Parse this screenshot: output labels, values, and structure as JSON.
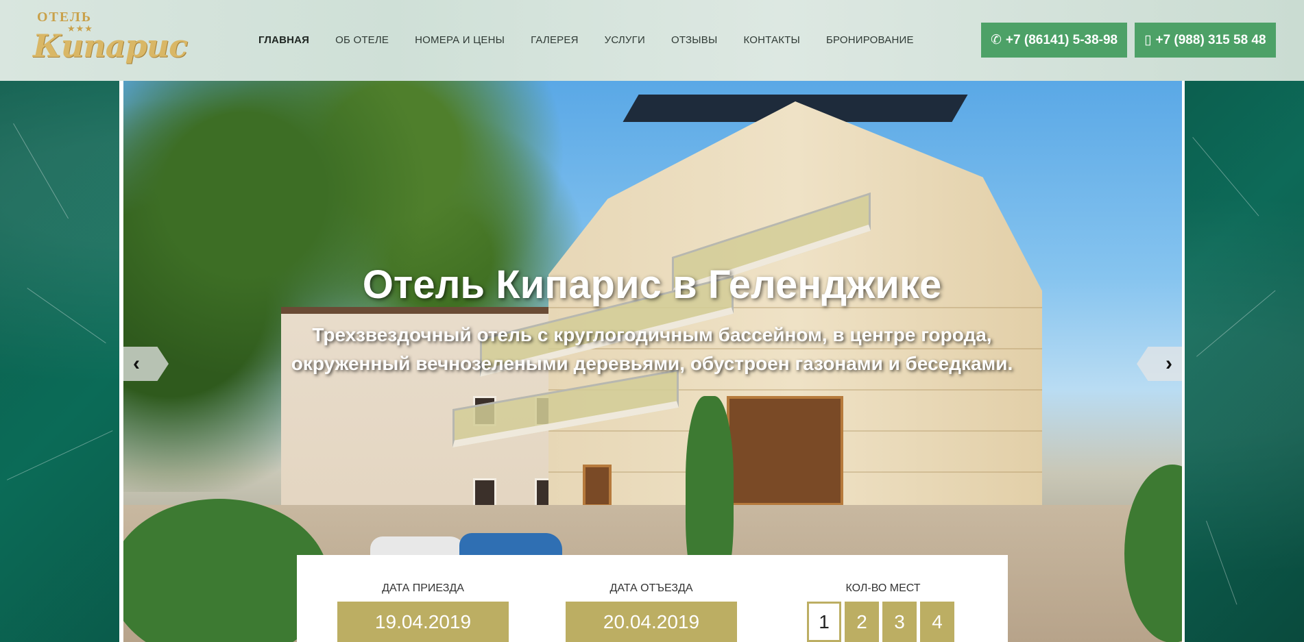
{
  "logo": {
    "small": "ОТЕЛЬ",
    "stars": "★★★",
    "big": "Кипарис"
  },
  "nav": [
    {
      "label": "ГЛАВНАЯ",
      "active": true
    },
    {
      "label": "ОБ ОТЕЛЕ"
    },
    {
      "label": "НОМЕРА И ЦЕНЫ"
    },
    {
      "label": "ГАЛЕРЕЯ"
    },
    {
      "label": "УСЛУГИ"
    },
    {
      "label": "ОТЗЫВЫ"
    },
    {
      "label": "КОНТАКТЫ"
    },
    {
      "label": "БРОНИРОВАНИЕ"
    }
  ],
  "phones": [
    {
      "number": "+7 (86141) 5-38-98",
      "icon": "phone-icon"
    },
    {
      "number": "+7 (988) 315 58 48",
      "icon": "mobile-icon"
    }
  ],
  "hero": {
    "title": "Отель Кипарис в Геленджике",
    "subtitle": "Трехзвездочный отель с круглогодичным бассейном, в центре города, окруженный вечнозелеными деревьями, обустроен газонами и беседками.",
    "prev": "‹",
    "next": "›"
  },
  "booking": {
    "arrival_label": "ДАТА ПРИЕЗДА",
    "arrival_value": "19.04.2019",
    "departure_label": "ДАТА ОТЪЕЗДА",
    "departure_value": "20.04.2019",
    "guests_label": "КОЛ-ВО МЕСТ",
    "guest_options": [
      "1",
      "2",
      "3",
      "4"
    ],
    "guests_selected": "1"
  },
  "colors": {
    "accent_green": "#4da167",
    "booking_gold": "#bcae63",
    "logo_gold": "#d9b766"
  }
}
